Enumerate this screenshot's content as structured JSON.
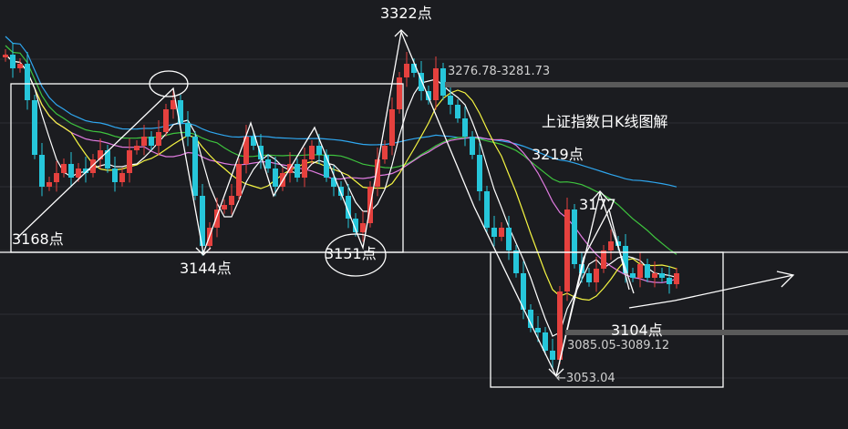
{
  "title": "上证指数日K线图解",
  "chart_data": {
    "type": "candlestick",
    "title": "上证指数日K线图解",
    "ylim": [
      3040,
      3340
    ],
    "annotations": {
      "peak_3322": "3322点",
      "low_3168": "3168点",
      "low_3144": "3144点",
      "low_3151": "3151点",
      "high_3219": "3219点",
      "high_3177": "3177",
      "low_3104": "3104点",
      "range_upper": "3276.78-3281.73",
      "range_lower": "3085.05-3089.12",
      "low_3053": "←3053.04"
    },
    "key_levels": [
      {
        "value": 3279.0,
        "label": "3276.78-3281.73"
      },
      {
        "value": 3087.0,
        "label": "3085.05-3089.12"
      },
      {
        "value": 3053.04,
        "label": "3053.04"
      }
    ],
    "pivots": [
      3168,
      3144,
      3151,
      3322,
      3219,
      3177,
      3104,
      3053.04
    ],
    "colors": {
      "background": "#1b1c20",
      "up": "#e5413e",
      "down": "#26c6da",
      "ma5": "#ffffff",
      "ma10": "#f5f542",
      "ma20": "#e07be0",
      "ma30": "#3ec43e",
      "ma60": "#2fa7f0",
      "annotation": "#ffffff"
    }
  }
}
